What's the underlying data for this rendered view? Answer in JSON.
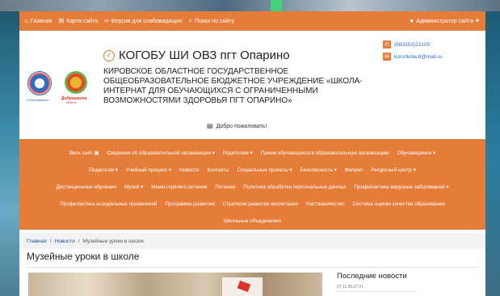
{
  "topbar": {
    "home": "Главная",
    "sitemap": "Карта сайта",
    "accessibility": "Версия для слабовидящих",
    "search": "Поиск по сайту",
    "admin": "Администратор сайта"
  },
  "header": {
    "title": "КОГОБУ ШИ ОВЗ пгт Опарино",
    "org_name": "КИРОВСКОЕ ОБЛАСТНОЕ ГОСУДАРСТВЕННОЕ ОБЩЕОБРАЗОВАТЕЛЬНОЕ БЮДЖЕТНОЕ УЧРЕЖДЕНИЕ «ШКОЛА-ИНТЕРНАТ ДЛЯ ОБУЧАЮЩИХСЯ С ОГРАНИЧЕННЫМИ ВОЗМОЖНОСТЯМИ ЗДОРОВЬЯ ПГТ ОПАРИНО»",
    "welcome": "Добро пожаловать!",
    "phone": "(883353)22105",
    "email": "korshkola.8@mail.ru",
    "logo1_caption": "«Образование»",
    "logo2_caption": "Доброшкола",
    "logo2_caption2": "Мебель"
  },
  "nav": {
    "line1": [
      "Весь сайт ▣",
      "Сведения об образовательной организации ▾",
      "Родителям ▾",
      "Прием обучающихся в образовательную организацию",
      "Обучающимся ▾"
    ],
    "line2": [
      "Педагогам ▾",
      "Учебный процесс ▾",
      "Новости",
      "Контакты",
      "Социальные проекты ▾",
      "Безопасность ▾",
      "Филиал",
      "Ресурсный центр ▾"
    ],
    "line3": [
      "Дистанционное обучение",
      "Музей ▾",
      "Меню горячего питания",
      "Питание",
      "Политика обработки персональных данных",
      "Профилактика вирусных заболеваний ▾"
    ],
    "line4": [
      "Профилактика асоциальных проявлений",
      "Программа развития",
      "Стратегия развития воспитания",
      "Наставничество",
      "Система оценки качества образования"
    ],
    "line5": [
      "Школьные объединения"
    ]
  },
  "breadcrumb": {
    "home": "Главная",
    "sep": "/",
    "news": "Новости",
    "current": "Музейные уроки в школе"
  },
  "page": {
    "title": "Музейные уроки в школе",
    "latest_news": "Последние новости",
    "latest_date": "07.11 05.07.21"
  },
  "colors": {
    "accent": "#e57c3a"
  }
}
